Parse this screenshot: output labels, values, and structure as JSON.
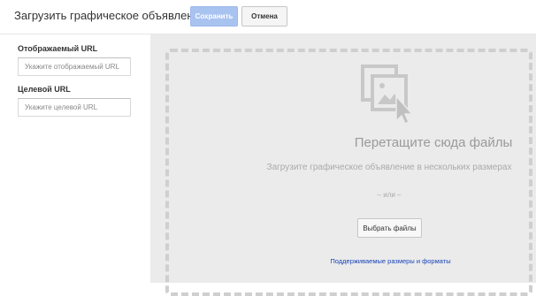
{
  "header": {
    "title": "Загрузить графическое объявление",
    "save_label": "Сохранить",
    "cancel_label": "Отмена"
  },
  "form": {
    "display_url": {
      "label": "Отображаемый URL",
      "placeholder": "Укажите отображаемый URL",
      "value": ""
    },
    "target_url": {
      "label": "Целевой URL",
      "placeholder": "Укажите целевой URL",
      "value": ""
    }
  },
  "dropzone": {
    "icon": "upload-images-icon",
    "title": "Перетащите сюда файлы",
    "subtitle": "Загрузите графическое объявление в нескольких размерах",
    "or_text": "– или –",
    "choose_files_label": "Выбрать файлы",
    "formats_link": "Поддерживаемые размеры и форматы"
  },
  "colors": {
    "save_button": "#a9c3f1",
    "link": "#1a44b8",
    "dropzone_bg": "#ebebeb"
  }
}
